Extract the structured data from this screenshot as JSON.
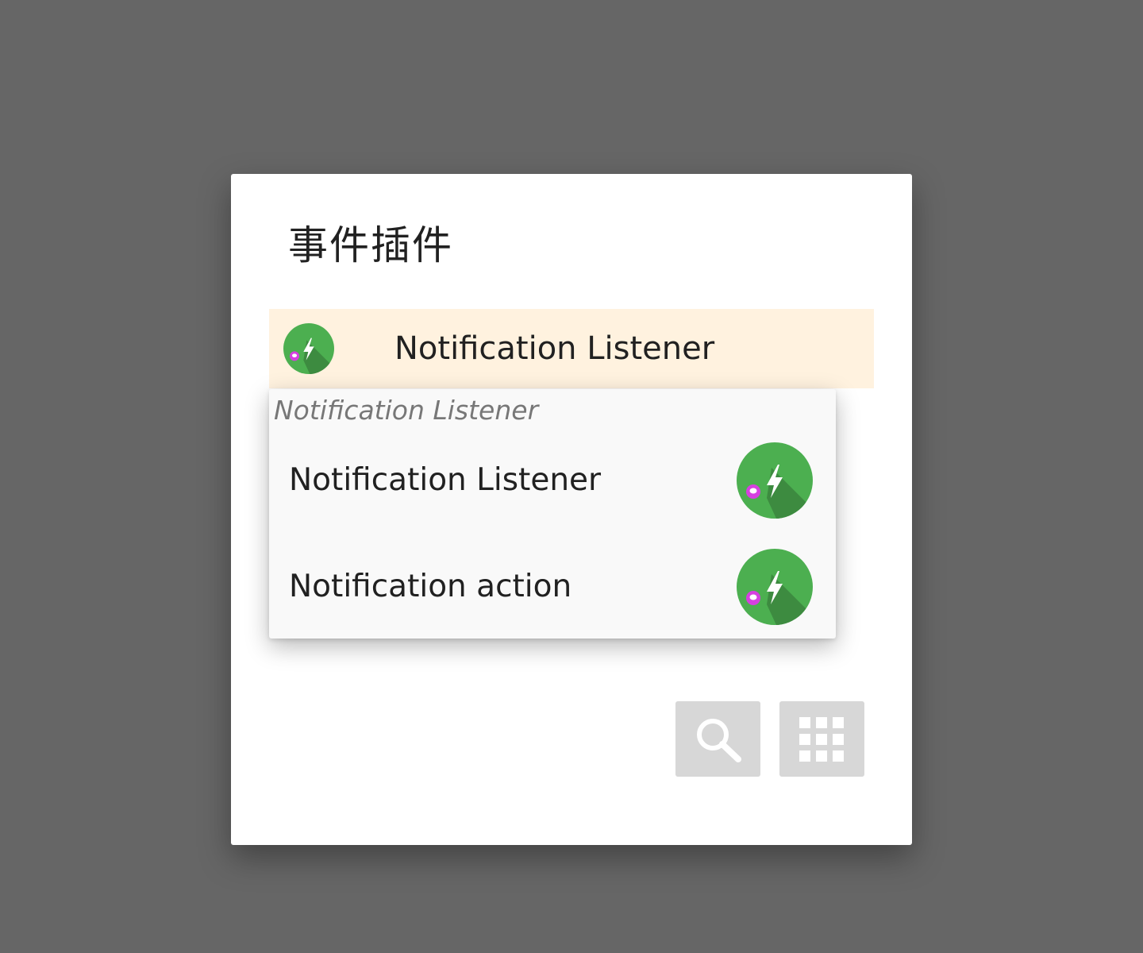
{
  "dialog": {
    "title": "事件插件",
    "selected_item": {
      "label": "Notification Listener",
      "icon": "plugin-bolt-icon"
    }
  },
  "dropdown": {
    "header": "Notification Listener",
    "items": [
      {
        "label": "Notification Listener",
        "icon": "plugin-bolt-icon"
      },
      {
        "label": "Notification action",
        "icon": "plugin-bolt-icon"
      }
    ]
  },
  "buttons": {
    "search_icon": "search-icon",
    "grid_icon": "grid-icon"
  },
  "colors": {
    "scrim": "#666666",
    "selected_bg": "#fff2df",
    "icon_green": "#4caf50",
    "icon_shadow": "#3d8b40",
    "badge_magenta": "#d640e0",
    "button_bg": "#d7d7d7"
  }
}
